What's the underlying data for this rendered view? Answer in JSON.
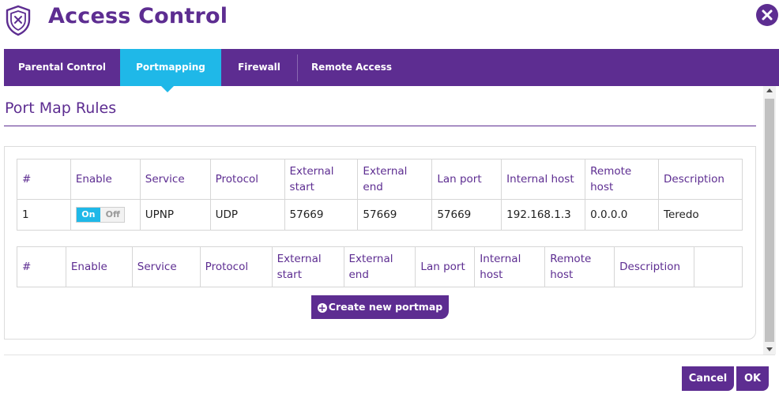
{
  "header": {
    "title": "Access Control",
    "icon": "shield-x-icon",
    "close_icon": "close-icon"
  },
  "tabs": [
    {
      "label": "Parental Control",
      "active": false
    },
    {
      "label": "Portmapping",
      "active": true
    },
    {
      "label": "Firewall",
      "active": false
    },
    {
      "label": "Remote Access",
      "active": false
    }
  ],
  "section": {
    "title": "Port Map Rules"
  },
  "rules_table": {
    "columns": [
      "#",
      "Enable",
      "Service",
      "Protocol",
      "External start",
      "External end",
      "Lan port",
      "Internal host",
      "Remote host",
      "Description"
    ],
    "rows": [
      {
        "num": "1",
        "enable": {
          "on_label": "On",
          "off_label": "Off",
          "state": "On"
        },
        "service": "UPNP",
        "protocol": "UDP",
        "external_start": "57669",
        "external_end": "57669",
        "lan_port": "57669",
        "internal_host": "192.168.1.3",
        "remote_host": "0.0.0.0",
        "description": "Teredo"
      }
    ]
  },
  "new_table": {
    "columns": [
      "#",
      "Enable",
      "Service",
      "Protocol",
      "External start",
      "External end",
      "Lan port",
      "Internal host",
      "Remote host",
      "Description",
      ""
    ]
  },
  "create_button": {
    "label": "Create new portmap",
    "icon": "plus-circle-icon"
  },
  "footer": {
    "cancel_label": "Cancel",
    "ok_label": "OK"
  },
  "colors": {
    "brand": "#5d2d91",
    "accent": "#1fb8e8"
  }
}
